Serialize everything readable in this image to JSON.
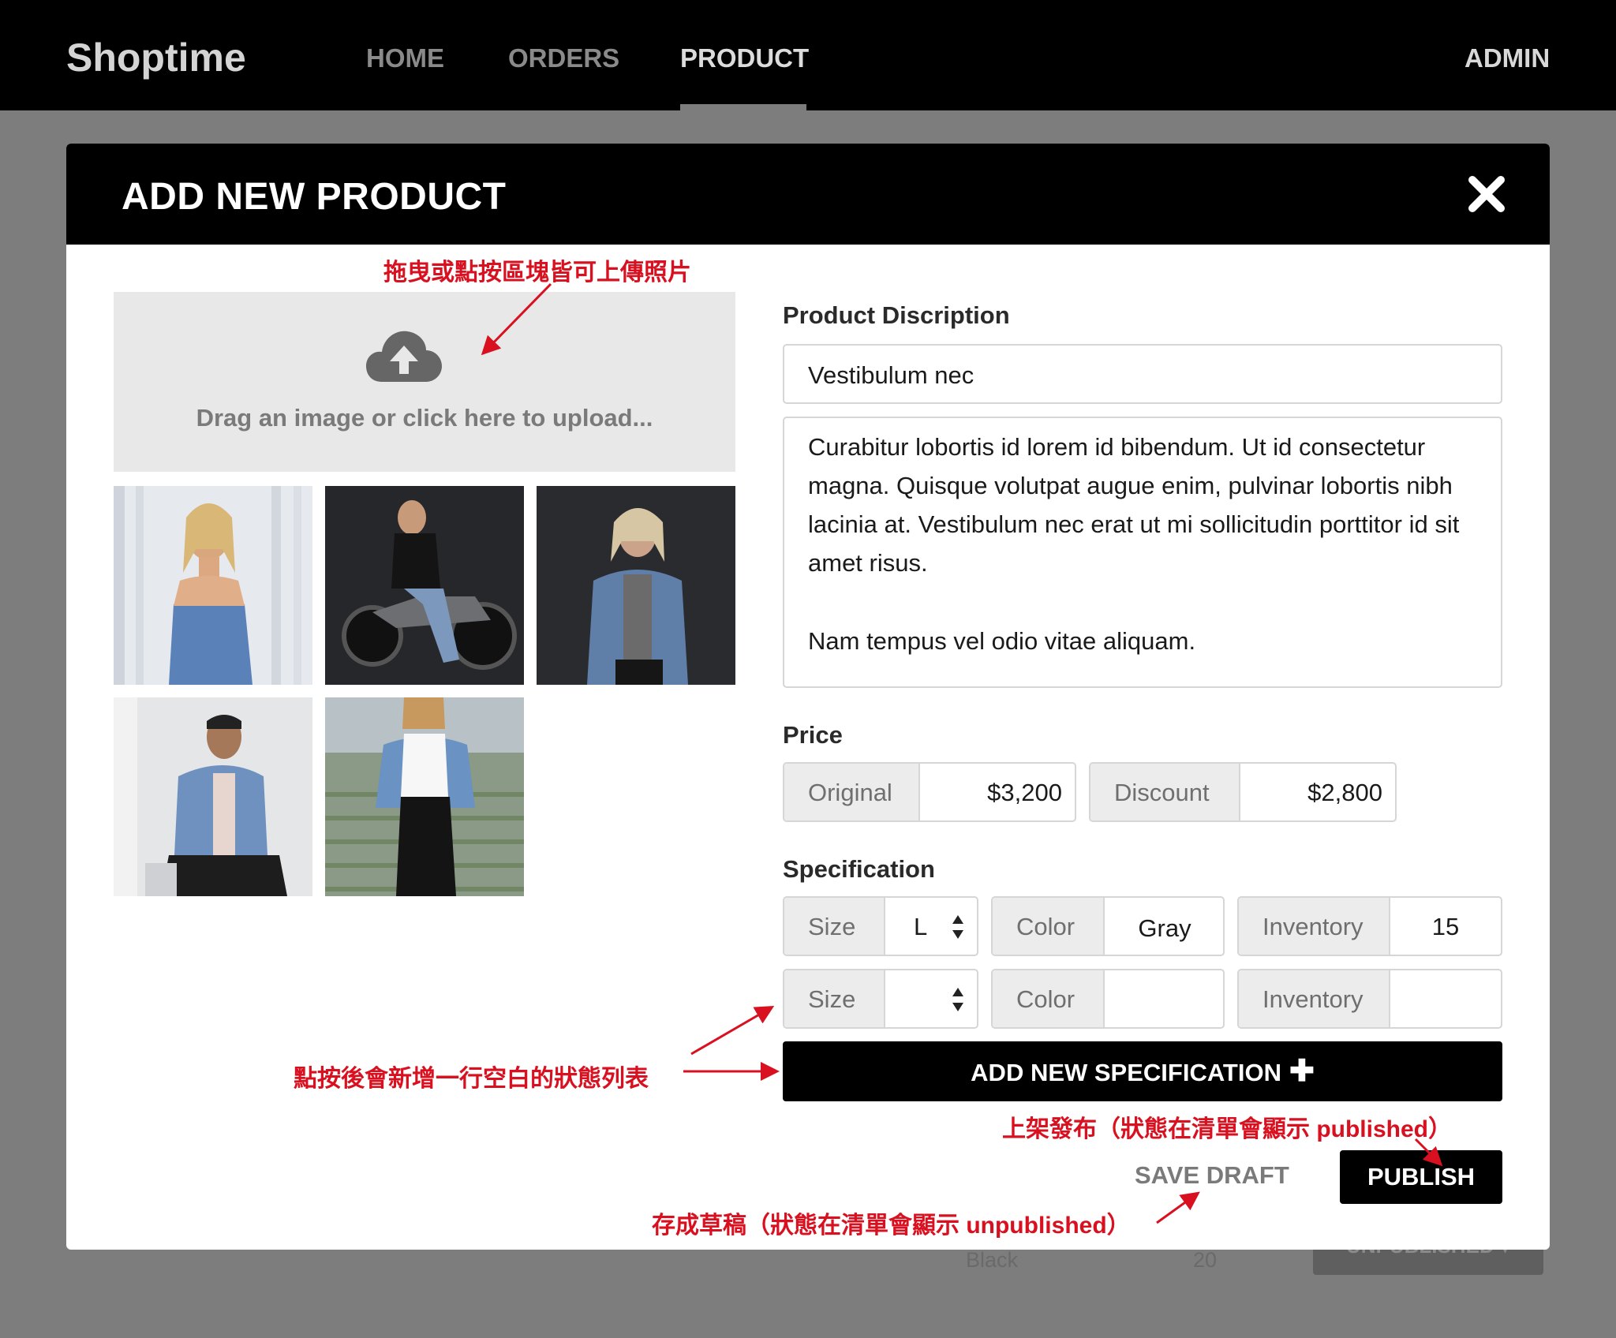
{
  "nav": {
    "brand": "Shoptime",
    "items": [
      {
        "label": "HOME",
        "active": false
      },
      {
        "label": "ORDERS",
        "active": false
      },
      {
        "label": "PRODUCT",
        "active": true
      }
    ],
    "user": "ADMIN"
  },
  "background_row": {
    "color": "Black",
    "inventory": "20",
    "status": "UNPUBLISHED ▾"
  },
  "modal": {
    "title": "ADD NEW PRODUCT",
    "close_icon": "close-icon",
    "upload": {
      "icon": "cloud-upload-icon",
      "text": "Drag an image or click here to upload..."
    },
    "photos": [
      "photo-woman-denim-top",
      "photo-woman-motorcycle",
      "photo-woman-denim-jacket",
      "photo-man-denim-jacket",
      "photo-woman-white-tank"
    ],
    "description": {
      "label": "Product Discription",
      "title_value": "Vestibulum nec",
      "body_paragraphs": [
        "Curabitur lobortis id lorem id bibendum. Ut id consectetur magna. Quisque volutpat augue enim, pulvinar lobortis nibh lacinia at. Vestibulum nec erat ut mi sollicitudin porttitor id sit amet risus.",
        "Nam tempus vel odio vitae aliquam."
      ]
    },
    "price": {
      "label": "Price",
      "original_label": "Original",
      "original_value": "$3,200",
      "discount_label": "Discount",
      "discount_value": "$2,800"
    },
    "specification": {
      "label": "Specification",
      "size_label": "Size",
      "color_label": "Color",
      "inventory_label": "Inventory",
      "rows": [
        {
          "size": "L",
          "color": "Gray",
          "inventory": "15"
        },
        {
          "size": "",
          "color": "",
          "inventory": ""
        }
      ],
      "add_button": "ADD NEW SPECIFICATION",
      "add_icon": "plus-icon"
    },
    "actions": {
      "save_draft": "SAVE DRAFT",
      "publish": "PUBLISH"
    }
  },
  "annotations": {
    "upload_note": "拖曳或點按區塊皆可上傳照片",
    "add_spec_note": "點按後會新增一行空白的狀態列表",
    "publish_note": "上架發布（狀態在清單會顯示 published）",
    "draft_note": "存成草稿（狀態在清單會顯示 unpublished）"
  },
  "colors": {
    "annotation": "#d8101f",
    "header": "#000000",
    "overlay": "#7d7d7d"
  }
}
